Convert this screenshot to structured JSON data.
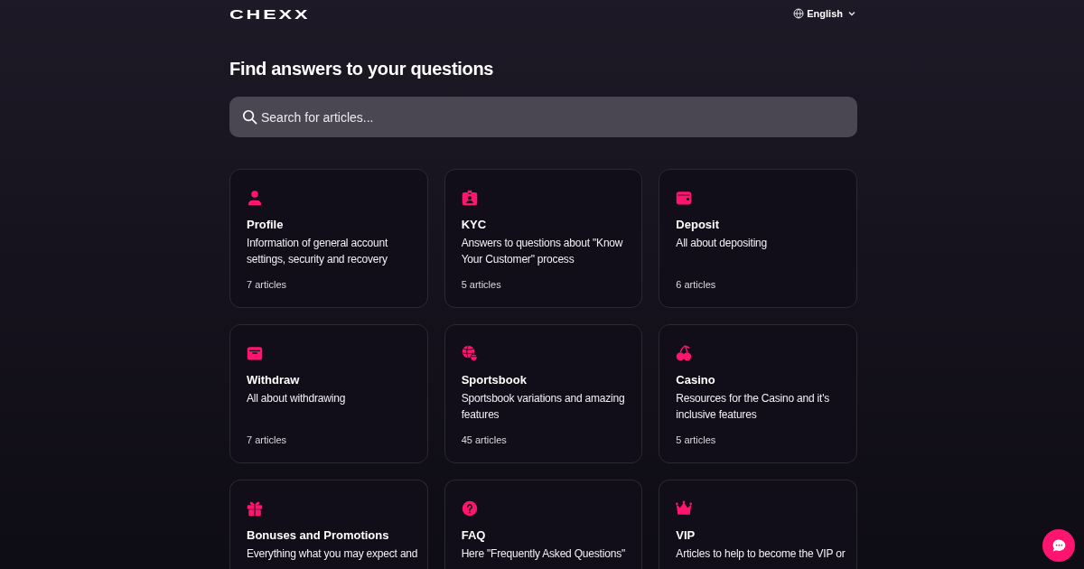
{
  "header": {
    "logo": "CHEXX",
    "language": "English"
  },
  "heading": "Find answers to your questions",
  "search": {
    "placeholder": "Search for articles..."
  },
  "categories": [
    {
      "kind": "person",
      "title": "Profile",
      "description": "Information of general account settings, security and recovery",
      "count": "7 articles"
    },
    {
      "kind": "badge",
      "title": "KYC",
      "description": "Answers to questions about \"Know Your Customer\" process",
      "count": "5 articles"
    },
    {
      "kind": "wallet",
      "title": "Deposit",
      "description": "All about depositing",
      "count": "6 articles"
    },
    {
      "kind": "purse",
      "title": "Withdraw",
      "description": "All about withdrawing",
      "count": "7 articles"
    },
    {
      "kind": "balls",
      "title": "Sportsbook",
      "description": "Sportsbook variations and amazing features",
      "count": "45 articles"
    },
    {
      "kind": "cherries",
      "title": "Casino",
      "description": "Resources for the Casino and it's inclusive features",
      "count": "5 articles"
    },
    {
      "kind": "gift",
      "title": "Bonuses and Promotions",
      "description": "Everything what you may expect and"
    },
    {
      "kind": "question",
      "title": "FAQ",
      "description": "Here \"Frequently Asked Questions\""
    },
    {
      "kind": "crown",
      "title": "VIP",
      "description": "Articles to help to become the VIP or"
    }
  ]
}
